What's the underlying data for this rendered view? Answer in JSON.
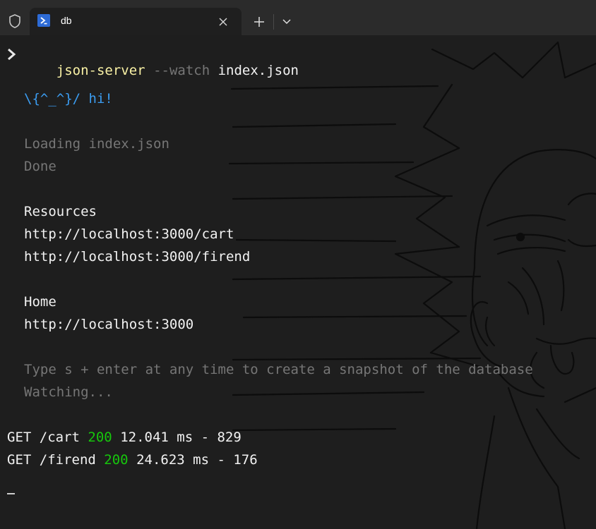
{
  "tab": {
    "title": "db",
    "icon": "powershell-icon"
  },
  "toolbar": {
    "new_tab_icon": "plus-icon",
    "dropdown_icon": "chevron-down-icon",
    "shield_icon": "shield-icon"
  },
  "terminal": {
    "command": {
      "program": "json-server",
      "flag": "--watch",
      "arg": "index.json"
    },
    "greeting": "\\{^_^}/ hi!",
    "loading": "Loading index.json",
    "done": "Done",
    "resources_heading": "Resources",
    "resources": [
      "http://localhost:3000/cart",
      "http://localhost:3000/firend"
    ],
    "home_heading": "Home",
    "home_url": "http://localhost:3000",
    "hint": "Type s + enter at any time to create a snapshot of the database",
    "watching": "Watching...",
    "requests": [
      {
        "method_path": "GET /cart",
        "status": "200",
        "rest": "12.041 ms - 829"
      },
      {
        "method_path": "GET /firend",
        "status": "200",
        "rest": "24.623 ms - 176"
      }
    ]
  },
  "colors": {
    "command": "#f9f1a5",
    "status_ok": "#16c60c",
    "greeting": "#3b9cf0",
    "dim": "#767676"
  }
}
